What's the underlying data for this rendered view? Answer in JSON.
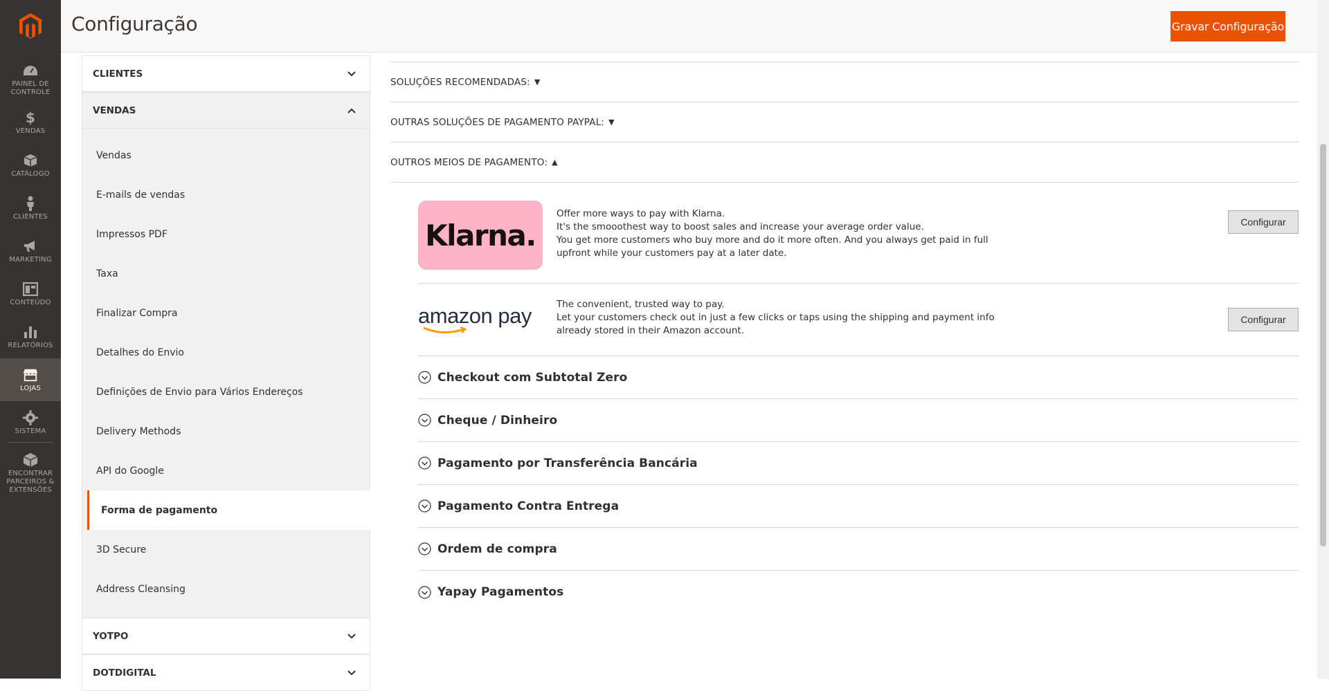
{
  "menu": {
    "items": [
      {
        "label": "PAINEL DE CONTROLE",
        "icon": "dashboard-icon"
      },
      {
        "label": "VENDAS",
        "icon": "dollar-icon"
      },
      {
        "label": "CATÁLOGO",
        "icon": "box-icon"
      },
      {
        "label": "CLIENTES",
        "icon": "person-icon"
      },
      {
        "label": "MARKETING",
        "icon": "megaphone-icon"
      },
      {
        "label": "CONTEÚDO",
        "icon": "layout-icon"
      },
      {
        "label": "RELATÓRIOS",
        "icon": "bar-chart-icon"
      },
      {
        "label": "LOJAS",
        "icon": "store-icon"
      },
      {
        "label": "SISTEMA",
        "icon": "gear-icon"
      },
      {
        "label": "ENCONTRAR PARCEIROS & EXTENSÕES",
        "icon": "partners-icon"
      }
    ]
  },
  "header": {
    "title": "Configuração",
    "save_label": "Gravar Configuração"
  },
  "nav": {
    "clientes": "CLIENTES",
    "vendas": "VENDAS",
    "links": [
      "Vendas",
      "E-mails de vendas",
      "Impressos PDF",
      "Taxa",
      "Finalizar Compra",
      "Detalhes do Envio",
      "Definições de Envio para Vários Endereços",
      "Delivery Methods",
      "API do Google",
      "Forma de pagamento",
      "3D Secure",
      "Address Cleansing"
    ],
    "yotpo": "YOTPO",
    "dotdigital": "DOTDIGITAL"
  },
  "content": {
    "groups": [
      {
        "label": "SOLUÇÕES RECOMENDADAS:",
        "arrow": "▼"
      },
      {
        "label": "OUTRAS SOLUÇÕES DE PAGAMENTO PAYPAL:",
        "arrow": "▼"
      },
      {
        "label": "OUTROS MEIOS DE PAGAMENTO:",
        "arrow": "▲"
      }
    ],
    "klarna": {
      "logo_text": "Klarna.",
      "lines": [
        "Offer more ways to pay with Klarna.",
        "It's the smooothest way to boost sales and increase your average order value.",
        "You get more customers who buy more and do it more often. And you always get paid in full upfront while your customers pay at a later date."
      ],
      "button": "Configurar"
    },
    "amazon": {
      "logo_text": "amazon pay",
      "lines": [
        "The convenient, trusted way to pay.",
        "Let your customers check out in just a few clicks or taps using the shipping and payment info already stored in their Amazon account."
      ],
      "button": "Configurar"
    },
    "methods": [
      "Checkout com Subtotal Zero",
      "Cheque / Dinheiro",
      "Pagamento por Transferência Bancária",
      "Pagamento Contra Entrega",
      "Ordem de compra",
      "Yapay Pagamentos"
    ]
  },
  "colors": {
    "accent": "#eb5202",
    "menu_bg": "#373330",
    "klarna_pink": "#ffb3c7"
  }
}
